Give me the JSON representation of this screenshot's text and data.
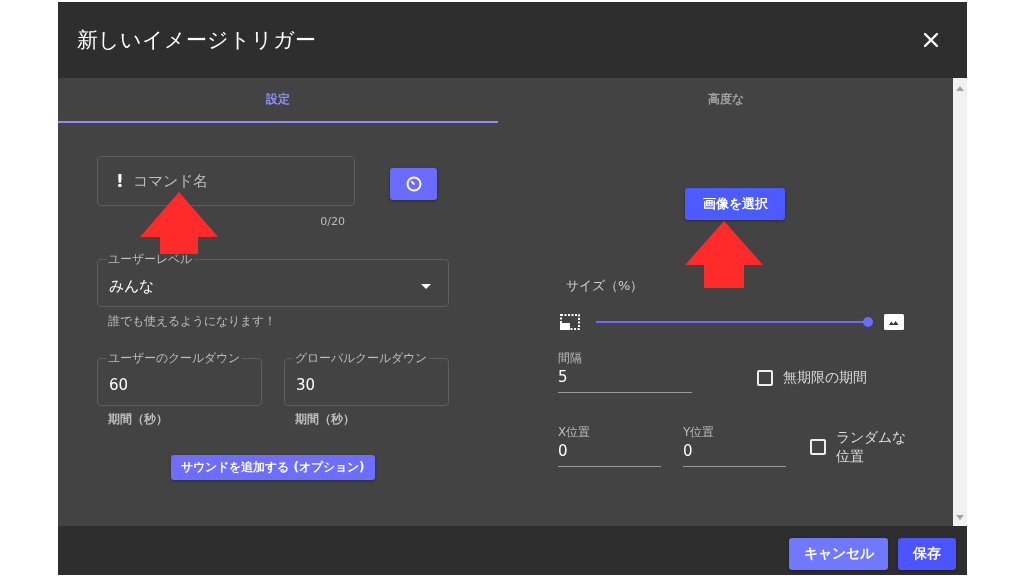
{
  "dialog": {
    "title": "新しいイメージトリガー"
  },
  "tabs": [
    {
      "label": "設定",
      "selected": true
    },
    {
      "label": "高度な",
      "selected": false
    }
  ],
  "settings": {
    "command_field": {
      "prefix": "!",
      "placeholder": "コマンド名",
      "counter": "0/20"
    },
    "user_level": {
      "label": "ユーザーレベル",
      "value": "みんな",
      "hint": "誰でも使えるようになります！"
    },
    "cooldowns": [
      {
        "label": "ユーザーのクールダウン",
        "value": "60",
        "hint": "期間（秒）"
      },
      {
        "label": "グローバルクールダウン",
        "value": "30",
        "hint": "期間（秒）"
      }
    ],
    "sound_button": "サウンドを追加する (オプション)"
  },
  "image": {
    "select_button": "画像を選択",
    "size": {
      "label": "サイズ（%）",
      "level": 1
    },
    "duration": {
      "label": "間隔",
      "value": "5"
    },
    "infinite": {
      "label": "無期限の期間",
      "checked": false
    },
    "positions": [
      {
        "label": "X位置",
        "value": "0"
      },
      {
        "label": "Y位置",
        "value": "0"
      }
    ],
    "random": {
      "label": "ランダムな位置",
      "checked": false
    }
  },
  "footer": {
    "buttons": [
      {
        "label": "キャンセル",
        "kind": "secondary"
      },
      {
        "label": "保存",
        "kind": "primary"
      }
    ]
  }
}
